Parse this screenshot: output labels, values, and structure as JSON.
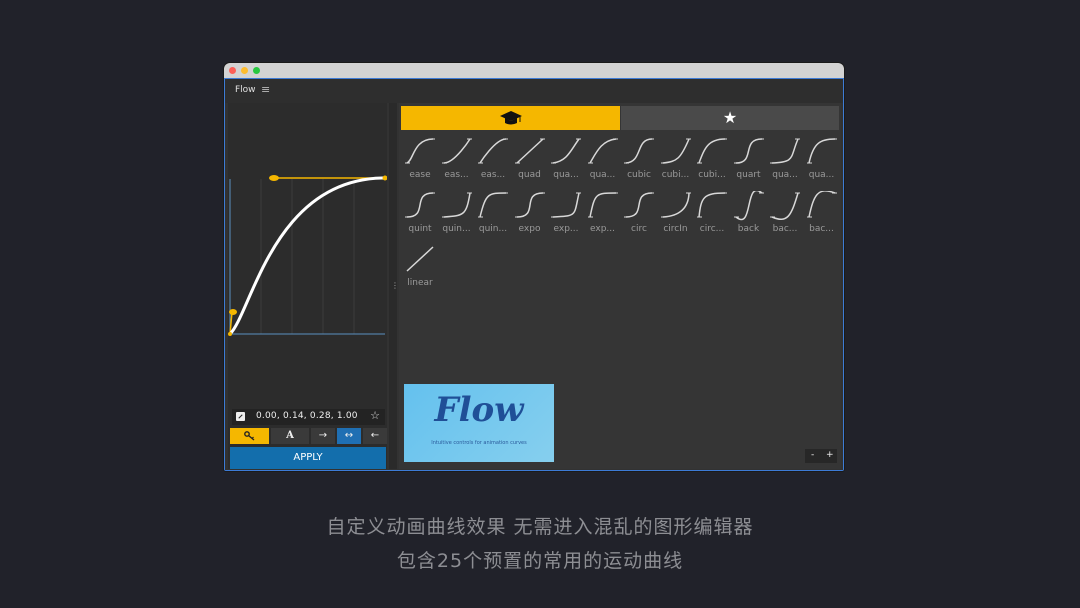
{
  "window": {
    "title": "Flow",
    "menu_icon": "hamburger-icon"
  },
  "curve": {
    "values": "0.00, 0.14, 0.28, 1.00"
  },
  "tools": {
    "key_icon": "key-icon",
    "text_label": "A",
    "arrow_right": "→",
    "arrow_both": "↔",
    "arrow_left": "←"
  },
  "apply_label": "APPLY",
  "tabs": {
    "presets_icon": "graduation-cap-icon",
    "favorites_icon": "star-icon",
    "favorites_glyph": "★"
  },
  "presets": [
    {
      "label": "ease"
    },
    {
      "label": "eas..."
    },
    {
      "label": "eas..."
    },
    {
      "label": "quad"
    },
    {
      "label": "qua..."
    },
    {
      "label": "qua..."
    },
    {
      "label": "cubic"
    },
    {
      "label": "cubi..."
    },
    {
      "label": "cubi..."
    },
    {
      "label": "quart"
    },
    {
      "label": "qua..."
    },
    {
      "label": "qua..."
    },
    {
      "label": "quint"
    },
    {
      "label": "quin..."
    },
    {
      "label": "quin..."
    },
    {
      "label": "expo"
    },
    {
      "label": "exp..."
    },
    {
      "label": "exp..."
    },
    {
      "label": "circ"
    },
    {
      "label": "circIn"
    },
    {
      "label": "circ..."
    },
    {
      "label": "back"
    },
    {
      "label": "bac..."
    },
    {
      "label": "bac..."
    },
    {
      "label": "linear"
    }
  ],
  "logo": {
    "text": "Flow",
    "subtitle": "Intuitive controls for animation curves"
  },
  "zoom": {
    "minus": "-",
    "plus": "+"
  },
  "captions": {
    "line1": "自定义动画曲线效果  无需进入混乱的图形编辑器",
    "line2": "包含25个预置的常用的运动曲线"
  },
  "colors": {
    "accent": "#f5b700",
    "apply": "#136eac",
    "background": "#21222a"
  }
}
